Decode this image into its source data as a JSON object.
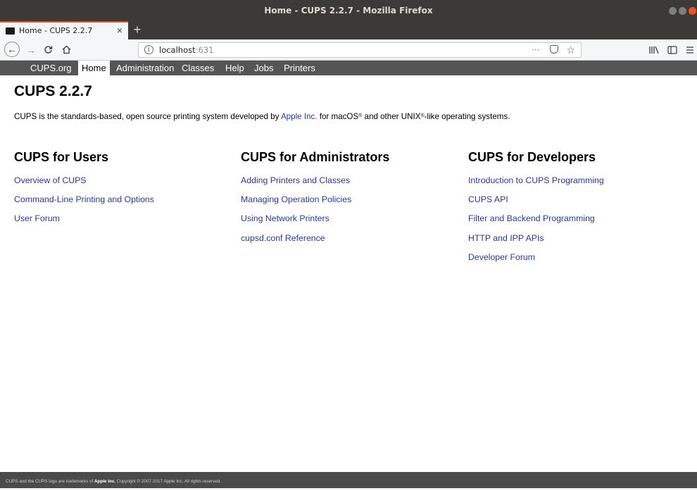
{
  "window": {
    "title": "Home - CUPS 2.2.7 - Mozilla Firefox"
  },
  "tabs": [
    {
      "label": "Home - CUPS 2.2.7",
      "active": true
    }
  ],
  "newtab_glyph": "+",
  "tab_close_glyph": "×",
  "address_bar": {
    "host": "localhost",
    "port": ":631",
    "more_glyph": "···"
  },
  "cups_nav": {
    "items": [
      {
        "label": "CUPS.org",
        "active": false
      },
      {
        "label": "Home",
        "active": true
      },
      {
        "label": "Administration",
        "active": false
      },
      {
        "label": "Classes",
        "active": false
      },
      {
        "label": "Help",
        "active": false
      },
      {
        "label": "Jobs",
        "active": false
      },
      {
        "label": "Printers",
        "active": false
      }
    ]
  },
  "page": {
    "title": "CUPS 2.2.7",
    "intro_before": "CUPS is the standards-based, open source printing system developed by ",
    "intro_link": "Apple Inc.",
    "intro_mid1": " for macOS",
    "intro_reg": "®",
    "intro_mid2": " and other UNIX",
    "intro_reg2": "®",
    "intro_after": "-like operating systems."
  },
  "columns": [
    {
      "heading": "CUPS for Users",
      "links": [
        "Overview of CUPS",
        "Command-Line Printing and Options",
        "User Forum"
      ]
    },
    {
      "heading": "CUPS for Administrators",
      "links": [
        "Adding Printers and Classes",
        "Managing Operation Policies",
        "Using Network Printers",
        "cupsd.conf Reference"
      ]
    },
    {
      "heading": "CUPS for Developers",
      "links": [
        "Introduction to CUPS Programming",
        "CUPS API",
        "Filter and Backend Programming",
        "HTTP and IPP APIs",
        "Developer Forum"
      ]
    }
  ],
  "footer": {
    "text_before": "CUPS and the CUPS logo are trademarks of ",
    "apple": "Apple Inc.",
    "text_after": " Copyright © 2007-2017 Apple Inc. All rights reserved."
  },
  "colors": {
    "accent": "#e95420",
    "link": "#2438a3",
    "nav_bg": "#555555"
  }
}
